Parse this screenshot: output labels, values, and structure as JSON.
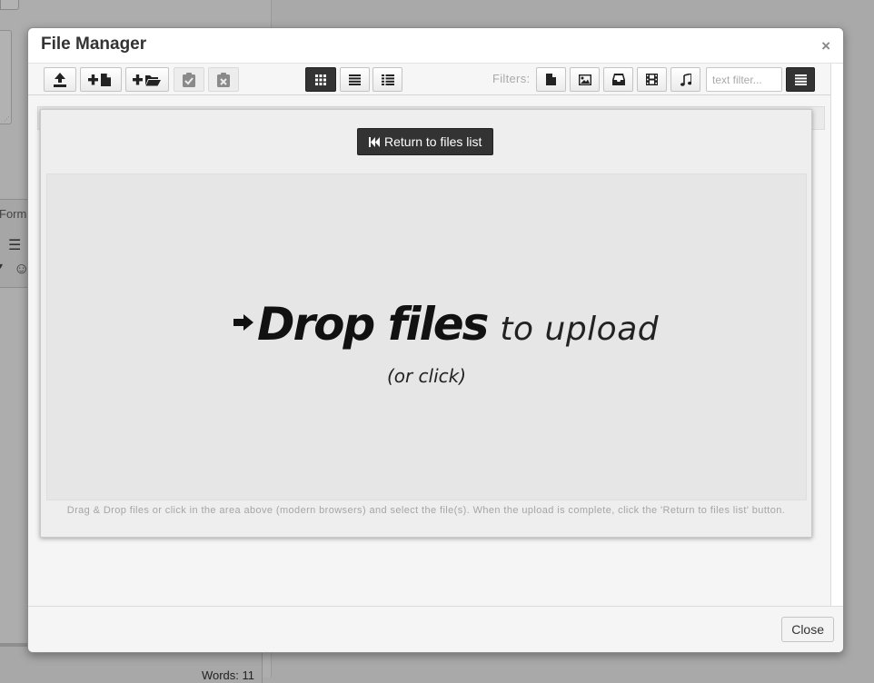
{
  "background": {
    "format_label": "Form",
    "words_label": "Words: 11"
  },
  "modal": {
    "title": "File Manager",
    "close_x": "×",
    "close_button": "Close"
  },
  "toolbar": {
    "actions": [
      {
        "name": "upload-button",
        "icon": "upload-icon"
      },
      {
        "name": "new-file-button",
        "icon": "plus-file-icon"
      },
      {
        "name": "new-folder-button",
        "icon": "plus-folder-icon"
      },
      {
        "name": "paste-button",
        "icon": "clipboard-check-icon",
        "disabled": true
      },
      {
        "name": "clear-clipboard-button",
        "icon": "clipboard-x-icon",
        "disabled": true
      }
    ],
    "view_modes": [
      {
        "name": "grid-view-button",
        "icon": "grid-icon",
        "active": true
      },
      {
        "name": "list-view-button",
        "icon": "list-icon",
        "active": false
      },
      {
        "name": "columns-view-button",
        "icon": "columns-list-icon",
        "active": false
      }
    ],
    "filters_label": "Filters:",
    "filters": [
      {
        "name": "filter-files",
        "icon": "file-icon"
      },
      {
        "name": "filter-images",
        "icon": "image-icon"
      },
      {
        "name": "filter-archives",
        "icon": "inbox-icon"
      },
      {
        "name": "filter-videos",
        "icon": "film-icon"
      },
      {
        "name": "filter-music",
        "icon": "music-icon"
      }
    ],
    "text_filter_placeholder": "text filter...",
    "sort_icon": "menu-icon"
  },
  "upload": {
    "return_button": "Return to files list",
    "drop_bold": "Drop files",
    "drop_light": "to upload",
    "drop_click": "(or click)",
    "help_text": "Drag & Drop files or click in the area above (modern browsers) and select the file(s). When the upload is complete, click the 'Return to files list' button."
  },
  "colors": {
    "overlay": "#a9a9a9",
    "dark_button": "#333333",
    "panel": "#eeeeee"
  }
}
